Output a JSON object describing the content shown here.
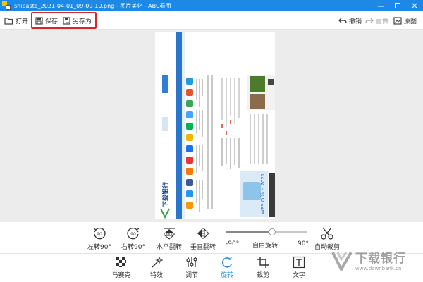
{
  "window": {
    "title": "snipaste_2021-04-01_09-09-10.png - 图片美化 - ABC看图",
    "accent": "#1e88e5"
  },
  "toolbar": {
    "open_label": "打开",
    "save_label": "保存",
    "saveas_label": "另存为",
    "undo_label": "撤销",
    "redo_label": "重做",
    "original_label": "原图",
    "highlight_color": "#d62828"
  },
  "controls": {
    "rotate_left_label": "左转90°",
    "rotate_right_label": "右转90°",
    "flip_h_label": "水平翻转",
    "flip_v_label": "垂直翻转",
    "rotate_badge": "90",
    "free_rotate": {
      "label": "自由旋转",
      "min_label": "-90°",
      "max_label": "90°",
      "min": -90,
      "max": 90,
      "value": 12
    },
    "auto_crop_label": "自动裁剪"
  },
  "tabs": [
    {
      "label": "马赛克",
      "icon": "mosaic-icon",
      "active": false
    },
    {
      "label": "特效",
      "icon": "magic-wand-icon",
      "active": false
    },
    {
      "label": "调节",
      "icon": "sliders-icon",
      "active": false
    },
    {
      "label": "旋转",
      "icon": "rotate-icon",
      "active": true
    },
    {
      "label": "裁剪",
      "icon": "crop-icon",
      "active": false
    },
    {
      "label": "文字",
      "icon": "text-icon",
      "active": false
    }
  ],
  "watermark": {
    "name": "下载银行",
    "url": "www.downbank.cn"
  },
  "photo": {
    "brand": "下载银行",
    "banner_text": "WPS Office 2021"
  }
}
